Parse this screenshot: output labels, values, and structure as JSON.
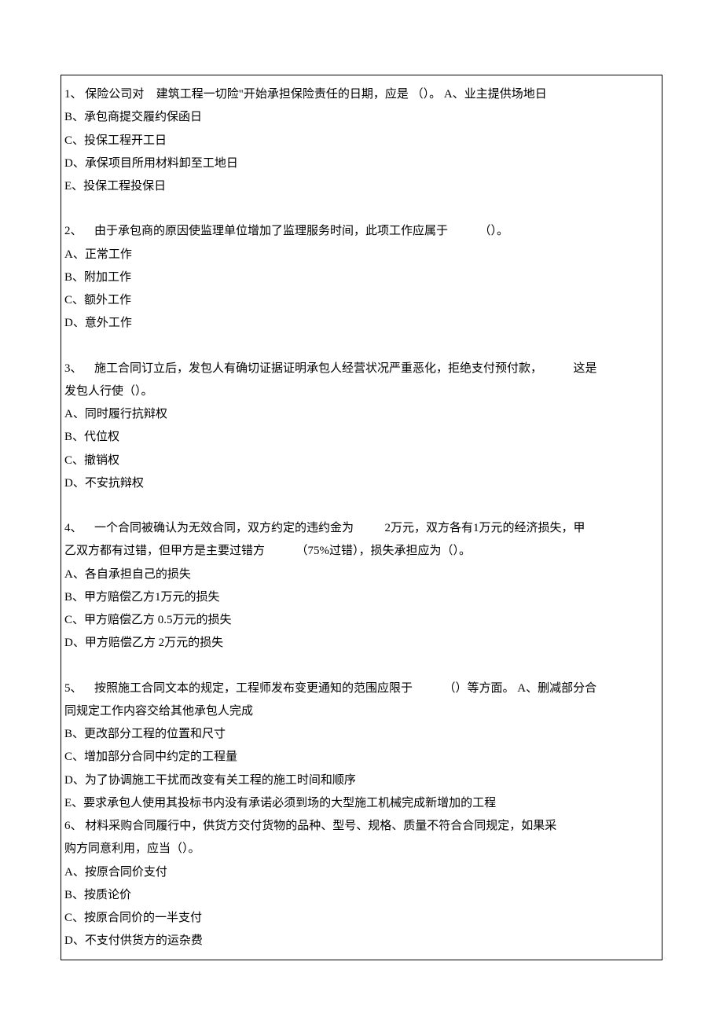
{
  "questions": [
    {
      "num": "1、",
      "stem_a": "保险公司对",
      "stem_b": "建筑工程一切险\"开始承担保险责任的日期，应是 （）。",
      "inline_opt": "A、业主提供场地日",
      "opts": [
        "B、承包商提交履约保函日",
        "C、投保工程开工日",
        "D、承保项目所用材料卸至工地日",
        "E、投保工程投保日"
      ]
    },
    {
      "num": "2、",
      "stem_a": "由于承包商的原因使监理单位增加了监理服务时间，此项工作应属于",
      "stem_tail": "（）。",
      "opts": [
        "A、正常工作",
        "B、附加工作",
        "C、额外工作",
        "D、意外工作"
      ]
    },
    {
      "num": "3、",
      "stem_a": "施工合同订立后，发包人有确切证据证明承包人经营状况严重恶化，拒绝支付预付款，",
      "stem_tail": "这是",
      "stem_line2": "发包人行使（）。",
      "opts": [
        "A、同时履行抗辩权",
        "B、代位权",
        "C、撤销权",
        "D、不安抗辩权"
      ]
    },
    {
      "num": "4、",
      "stem_a": "一个合同被确认为无效合同，双方约定的违约金为",
      "stem_mid": "2万元，双方各有1万元的经济损失，甲",
      "stem_line2_a": "乙双方都有过错，但甲方是主要过错方",
      "stem_line2_b": "（75%过错），损失承担应为（）。",
      "opts": [
        "A、各自承担自己的损失",
        "B、甲方赔偿乙方1万元的损失",
        "C、甲方赔偿乙方 0.5万元的损失",
        "D、甲方赔偿乙方 2万元的损失"
      ]
    },
    {
      "num": "5、",
      "stem_a": "按照施工合同文本的规定，工程师发布变更通知的范围应限于",
      "stem_tail": "（）等方面。",
      "inline_opt": "A、删减部分合",
      "stem_line2": "同规定工作内容交给其他承包人完成",
      "opts": [
        "B、更改部分工程的位置和尺寸",
        "C、增加部分合同中约定的工程量",
        "D、为了协调施工干扰而改变有关工程的施工时间和顺序",
        "E、要求承包人使用其投标书内没有承诺必须到场的大型施工机械完成新增加的工程"
      ]
    },
    {
      "num": "6、",
      "stem_a": "材料采购合同履行中，供货方交付货物的品种、型号、规格、质量不符合合同规定，如果采",
      "stem_line2": "购方同意利用，应当（）。",
      "opts": [
        "A、按原合同价支付",
        "B、按质论价",
        "C、按原合同价的一半支付",
        "D、不支付供货方的运杂费"
      ]
    }
  ]
}
